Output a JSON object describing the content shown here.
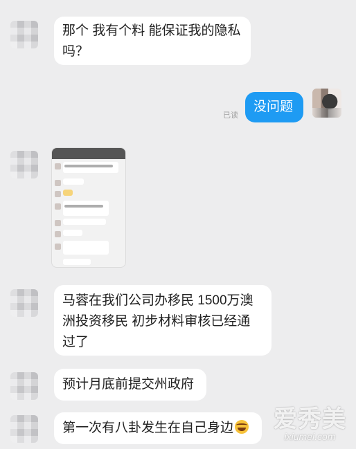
{
  "messages": [
    {
      "text1": "那个 我有个料 能保证我的隐私",
      "text2": "吗？"
    },
    {
      "text": "没问题",
      "read_label": "已读"
    },
    {
      "text1": "马蓉在我们公司办移民 1500万澳",
      "text2": "洲投资移民 初步材料审核已经通",
      "text3": "过了"
    },
    {
      "text": "预计月底前提交州政府"
    },
    {
      "text": "第一次有八卦发生在自己身边"
    }
  ],
  "watermark": {
    "name": "爱秀美",
    "url": "ixiumei.com"
  }
}
